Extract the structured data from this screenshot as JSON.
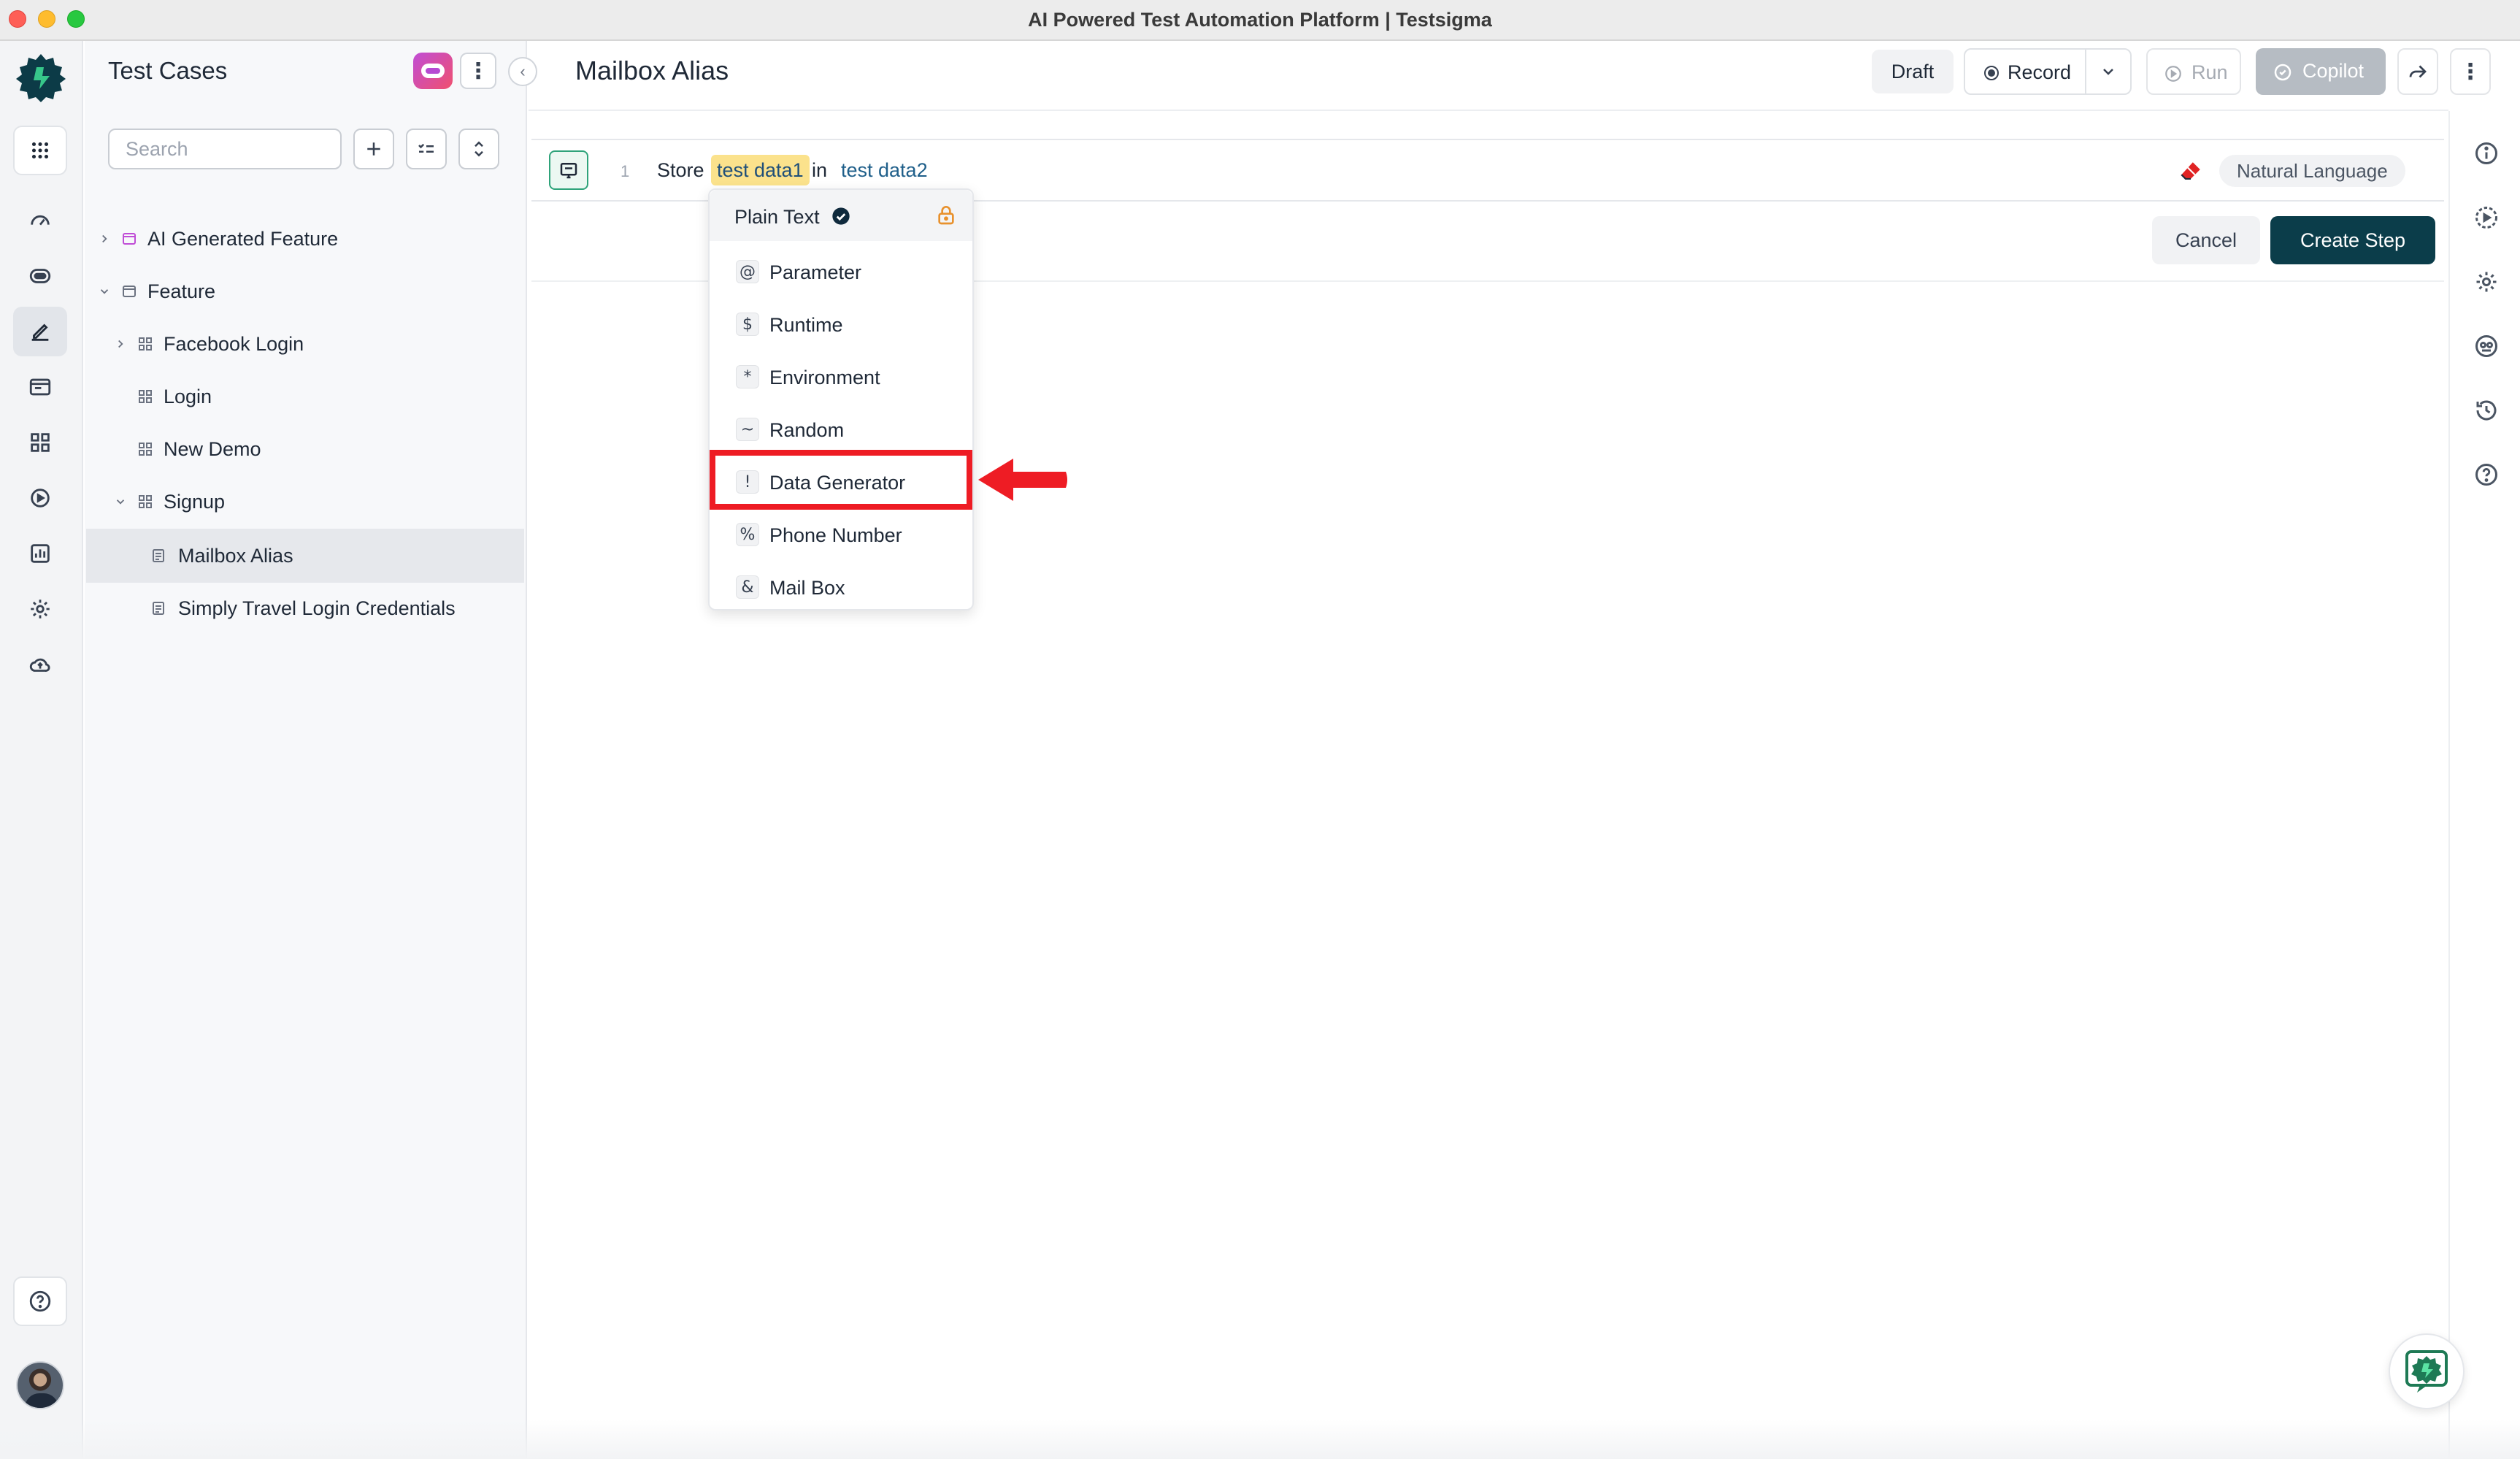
{
  "window": {
    "title": "AI Powered Test Automation Platform | Testsigma"
  },
  "rail": {
    "items": [
      "apps-grid-icon",
      "dashboard-icon",
      "robot-icon",
      "test-cases-icon",
      "test-data-icon",
      "elements-icon",
      "runs-icon",
      "reports-icon",
      "settings-icon",
      "cloud-upload-icon"
    ],
    "active": "test-cases-icon",
    "help_icon": "help-circle-icon"
  },
  "tree_panel": {
    "title": "Test Cases",
    "search": {
      "placeholder": "Search",
      "value": ""
    },
    "items": [
      {
        "label": "AI Generated Feature",
        "type": "feature-ai",
        "expanded": false
      },
      {
        "label": "Feature",
        "type": "feature",
        "expanded": true
      },
      {
        "label": "Facebook Login",
        "type": "suite",
        "expanded": false
      },
      {
        "label": "Login",
        "type": "suite"
      },
      {
        "label": "New Demo",
        "type": "suite"
      },
      {
        "label": "Signup",
        "type": "suite",
        "expanded": true
      },
      {
        "label": "Mailbox Alias",
        "type": "test-case",
        "selected": true
      },
      {
        "label": "Simply Travel Login Credentials",
        "type": "test-case"
      }
    ]
  },
  "header": {
    "title": "Mailbox Alias",
    "status": "Draft",
    "record_label": "Record",
    "run_label": "Run",
    "copilot_label": "Copilot"
  },
  "step": {
    "number": "1",
    "verb": "Store",
    "token1": "test data1",
    "connector": "in",
    "token2": "test data2",
    "mode": "Natural Language",
    "cancel_label": "Cancel",
    "create_label": "Create Step"
  },
  "dropdown": {
    "selected": "Plain Text",
    "items": [
      {
        "symbol": "@",
        "label": "Parameter"
      },
      {
        "symbol": "$",
        "label": "Runtime"
      },
      {
        "symbol": "*",
        "label": "Environment"
      },
      {
        "symbol": "~",
        "label": "Random"
      },
      {
        "symbol": "!",
        "label": "Data Generator"
      },
      {
        "symbol": "%",
        "label": "Phone Number"
      },
      {
        "symbol": "&",
        "label": "Mail Box"
      }
    ],
    "highlighted": "Data Generator"
  },
  "right_rail": [
    "info-icon",
    "run-history-icon",
    "settings-icon",
    "dry-run-icon",
    "history-icon",
    "help-icon"
  ],
  "colors": {
    "accent_dark": "#0b3d4a",
    "token_highlight": "#fbe28c",
    "annotation_red": "#ee1c24",
    "brand_green": "#2fa37a"
  }
}
